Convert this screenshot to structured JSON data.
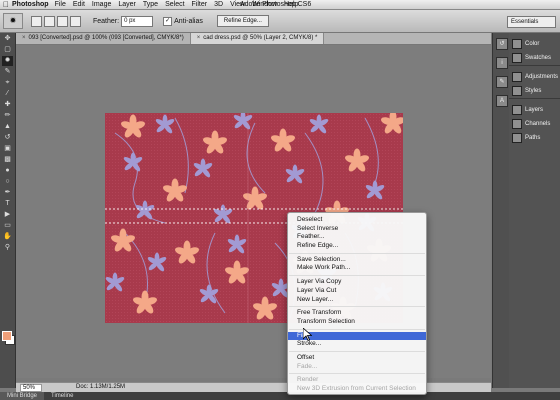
{
  "menubar": {
    "app": "Photoshop",
    "items": [
      "File",
      "Edit",
      "Image",
      "Layer",
      "Type",
      "Select",
      "Filter",
      "3D",
      "View",
      "Window",
      "Help"
    ],
    "window_title": "Adobe Photoshop CS6"
  },
  "options": {
    "feather_label": "Feather:",
    "feather_value": "0 px",
    "antialias_label": "Anti-alias",
    "antialias_checked": true,
    "refine_label": "Refine Edge...",
    "workspace": "Essentials"
  },
  "tabs": [
    {
      "label": "093 [Converted].psd @ 100% (093 [Converted], CMYK/8*)",
      "active": false
    },
    {
      "label": "cad dress.psd @ 50% (Layer 2, CMYK/8) *",
      "active": true
    }
  ],
  "status": {
    "zoom": "50%",
    "doc": "Doc: 1.13M/1.25M"
  },
  "bottom_tabs": [
    "Mini Bridge",
    "Timeline"
  ],
  "panels": [
    {
      "label": "Color",
      "icon": "color-icon"
    },
    {
      "label": "Swatches",
      "icon": "swatches-icon"
    },
    {
      "label": "Adjustments",
      "icon": "adjustments-icon"
    },
    {
      "label": "Styles",
      "icon": "styles-icon"
    },
    {
      "label": "Layers",
      "icon": "layers-icon"
    },
    {
      "label": "Channels",
      "icon": "channels-icon"
    },
    {
      "label": "Paths",
      "icon": "paths-icon"
    }
  ],
  "context_menu": [
    {
      "label": "Deselect"
    },
    {
      "label": "Select Inverse"
    },
    {
      "label": "Feather..."
    },
    {
      "label": "Refine Edge..."
    },
    {
      "sep": true
    },
    {
      "label": "Save Selection..."
    },
    {
      "label": "Make Work Path..."
    },
    {
      "sep": true
    },
    {
      "label": "Layer Via Copy"
    },
    {
      "label": "Layer Via Cut"
    },
    {
      "label": "New Layer..."
    },
    {
      "sep": true
    },
    {
      "label": "Free Transform"
    },
    {
      "label": "Transform Selection"
    },
    {
      "sep": true
    },
    {
      "label": "Fill...",
      "highlighted": true
    },
    {
      "label": "Stroke..."
    },
    {
      "sep": true
    },
    {
      "label": "Offset"
    },
    {
      "label": "Fade...",
      "disabled": true
    },
    {
      "sep": true
    },
    {
      "label": "Render",
      "disabled": true
    },
    {
      "label": "New 3D Extrusion from Current Selection",
      "disabled": true
    }
  ],
  "colors": {
    "pattern_bg": "#a83a4c",
    "petal_peach": "#f4a888",
    "petal_lilac": "#a29ad3",
    "foreground": "#f1a07a",
    "highlight": "#3f68d7"
  }
}
